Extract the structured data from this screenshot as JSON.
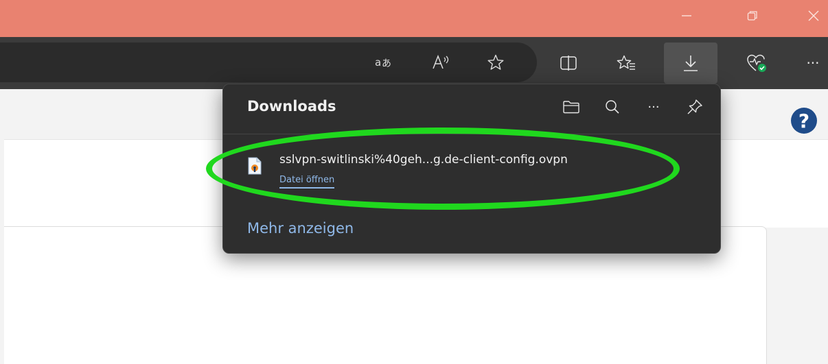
{
  "window": {
    "controls": [
      "minimize",
      "restore",
      "close"
    ]
  },
  "toolbar": {
    "icons": [
      "read-translate-icon",
      "read-aloud-icon",
      "favorite-star-icon",
      "split-screen-icon",
      "favorites-icon",
      "downloads-icon",
      "browser-essentials-icon",
      "more-icon"
    ],
    "more_label": "···"
  },
  "page": {
    "help_label": "?"
  },
  "downloads": {
    "title": "Downloads",
    "actions": [
      "open-folder-icon",
      "search-icon",
      "more-options-icon",
      "pin-icon"
    ],
    "more_options_label": "···",
    "items": [
      {
        "file_name": "sslvpn-switlinski%40geh...g.de-client-config.ovpn",
        "action_label": "Datei öffnen"
      }
    ],
    "show_more_label": "Mehr anzeigen"
  },
  "colors": {
    "titlebar": "#e98270",
    "toolbar": "#3b3b3b",
    "flyout": "#2e2e2e",
    "link": "#8fb8e8",
    "highlight": "#20d81e"
  }
}
